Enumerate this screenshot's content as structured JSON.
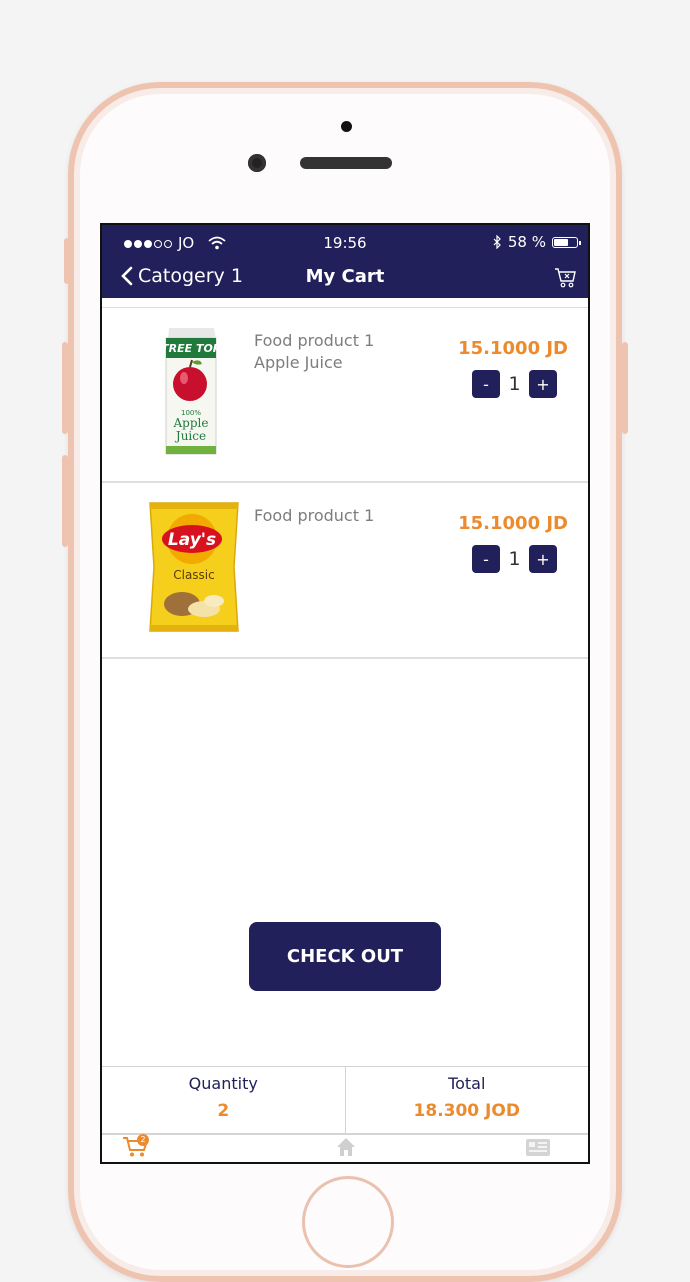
{
  "status_bar": {
    "carrier": "JO",
    "time": "19:56",
    "battery": "58 %",
    "battery_level": 0.58
  },
  "nav": {
    "back_label": "Catogery 1",
    "title": "My Cart"
  },
  "cart_items": [
    {
      "name_line1": "Food product 1",
      "name_line2": "Apple Juice",
      "price": "15.1000 JD",
      "quantity": "1",
      "image": "tree-top-apple-juice-image",
      "image_text": [
        "TREE TOP",
        "100%",
        "Apple",
        "Juice"
      ]
    },
    {
      "name_line1": "Food product 1",
      "name_line2": "",
      "price": "15.1000 JD",
      "quantity": "1",
      "image": "lays-classic-chips-image",
      "image_text": [
        "Lay's",
        "Classic"
      ]
    }
  ],
  "buttons": {
    "minus": "-",
    "plus": "+",
    "checkout": "CHECK OUT"
  },
  "summary": {
    "quantity_label": "Quantity",
    "quantity_value": "2",
    "total_label": "Total",
    "total_value": "18.300 JOD"
  },
  "tabbar": {
    "cart_badge": "2",
    "tabs": [
      "cart-icon",
      "home-icon",
      "offers-icon"
    ]
  },
  "colors": {
    "primary": "#22205a",
    "accent": "#ec8a2e",
    "muted_text": "#7d7d7d"
  }
}
